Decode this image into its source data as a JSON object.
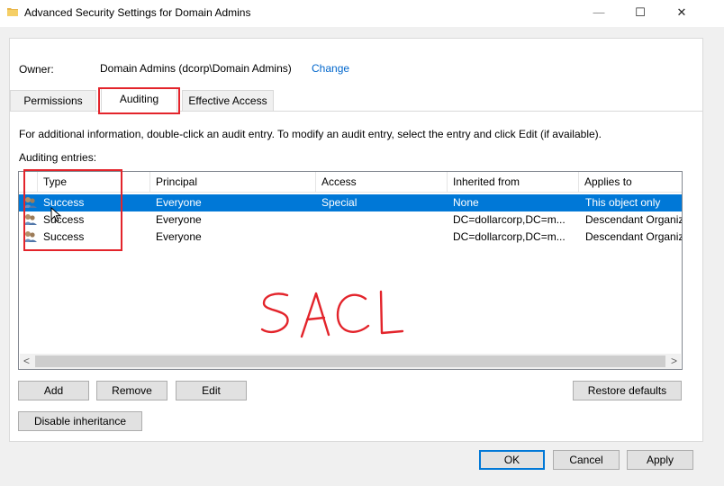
{
  "window": {
    "title": "Advanced Security Settings for Domain Admins",
    "minimize_glyph": "—",
    "maximize_glyph": "☐",
    "close_glyph": "✕",
    "folder_icon": "folder-icon"
  },
  "owner": {
    "label": "Owner:",
    "value": "Domain Admins (dcorp\\Domain Admins)",
    "change_link": "Change"
  },
  "tabs": [
    {
      "label": "Permissions",
      "active": false
    },
    {
      "label": "Auditing",
      "active": true
    },
    {
      "label": "Effective Access",
      "active": false
    }
  ],
  "info_text": "For additional information, double-click an audit entry. To modify an audit entry, select the entry and click Edit (if available).",
  "entries_label": "Auditing entries:",
  "table": {
    "columns": [
      "Type",
      "Principal",
      "Access",
      "Inherited from",
      "Applies to"
    ],
    "rows": [
      {
        "type": "Success",
        "principal": "Everyone",
        "access": "Special",
        "inherited_from": "None",
        "applies_to": "This object only",
        "selected": true
      },
      {
        "type": "Success",
        "principal": "Everyone",
        "access": "",
        "inherited_from": "DC=dollarcorp,DC=m...",
        "applies_to": "Descendant Organiz",
        "selected": false
      },
      {
        "type": "Success",
        "principal": "Everyone",
        "access": "",
        "inherited_from": "DC=dollarcorp,DC=m...",
        "applies_to": "Descendant Organiz",
        "selected": false
      }
    ],
    "scroll_left_glyph": "<",
    "scroll_right_glyph": ">"
  },
  "buttons": {
    "add": "Add",
    "remove": "Remove",
    "edit": "Edit",
    "restore_defaults": "Restore defaults",
    "disable_inheritance": "Disable inheritance",
    "ok": "OK",
    "cancel": "Cancel",
    "apply": "Apply"
  },
  "annotation": {
    "handwritten": "SACL",
    "color": "#e3242b"
  },
  "colors": {
    "selection": "#0078d7",
    "link": "#0066cc",
    "highlight_box": "#e3242b"
  }
}
